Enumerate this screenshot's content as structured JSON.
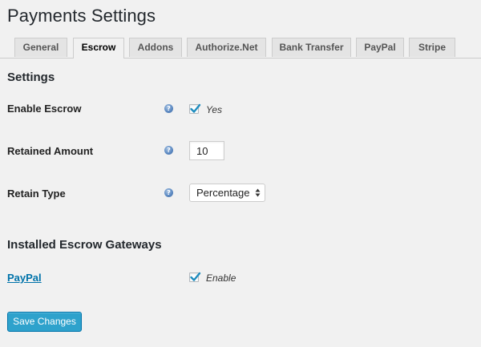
{
  "page": {
    "title": "Payments Settings"
  },
  "tabs": [
    {
      "label": "General",
      "active": false
    },
    {
      "label": "Escrow",
      "active": true
    },
    {
      "label": "Addons",
      "active": false
    },
    {
      "label": "Authorize.Net",
      "active": false
    },
    {
      "label": "Bank Transfer",
      "active": false
    },
    {
      "label": "PayPal",
      "active": false
    },
    {
      "label": "Stripe",
      "active": false
    }
  ],
  "settings": {
    "heading": "Settings",
    "enable_escrow": {
      "label": "Enable Escrow",
      "checked": true,
      "option_label": "Yes"
    },
    "retained_amount": {
      "label": "Retained Amount",
      "value": "10"
    },
    "retain_type": {
      "label": "Retain Type",
      "selected": "Percentage"
    }
  },
  "gateways": {
    "heading": "Installed Escrow Gateways",
    "items": [
      {
        "name": "PayPal",
        "checked": true,
        "option_label": "Enable"
      }
    ]
  },
  "actions": {
    "save_label": "Save Changes"
  },
  "colors": {
    "accent": "#2ea2cc",
    "link": "#0073aa",
    "background": "#f1f1f1"
  },
  "icons": {
    "help": "help-icon",
    "check": "check-icon",
    "select_arrows": "select-arrows-icon"
  }
}
